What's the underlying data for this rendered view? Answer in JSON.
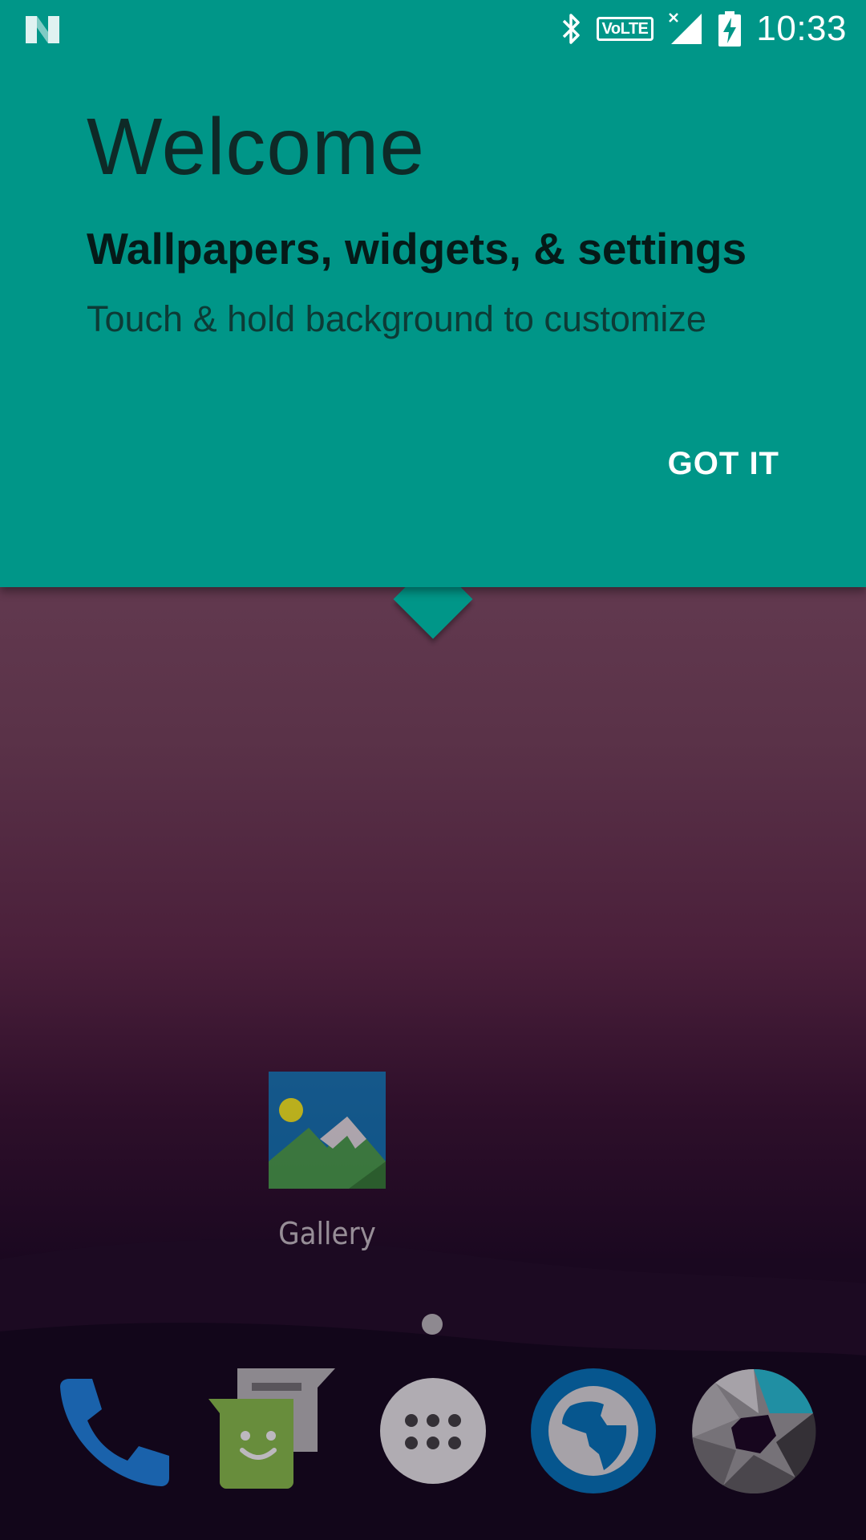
{
  "status_bar": {
    "time": "10:33",
    "volte_label": "VoLTE",
    "icons": [
      "android-n-icon",
      "bluetooth-icon",
      "volte-icon",
      "signal-no-data-icon",
      "battery-charging-icon"
    ]
  },
  "welcome": {
    "title": "Welcome",
    "subtitle": "Wallpapers, widgets, & settings",
    "description": "Touch & hold background to customize",
    "got_it_label": "GOT IT"
  },
  "home": {
    "apps": [
      {
        "label": "Gallery",
        "icon": "gallery-icon"
      }
    ],
    "page_count": 1
  },
  "dock": {
    "items": [
      "phone-icon",
      "messaging-icon",
      "all-apps-icon",
      "browser-icon",
      "camera-icon"
    ]
  },
  "colors": {
    "card": "#009688",
    "wallpaper_top": "#7a4c5e",
    "wallpaper_bottom": "#120516"
  }
}
